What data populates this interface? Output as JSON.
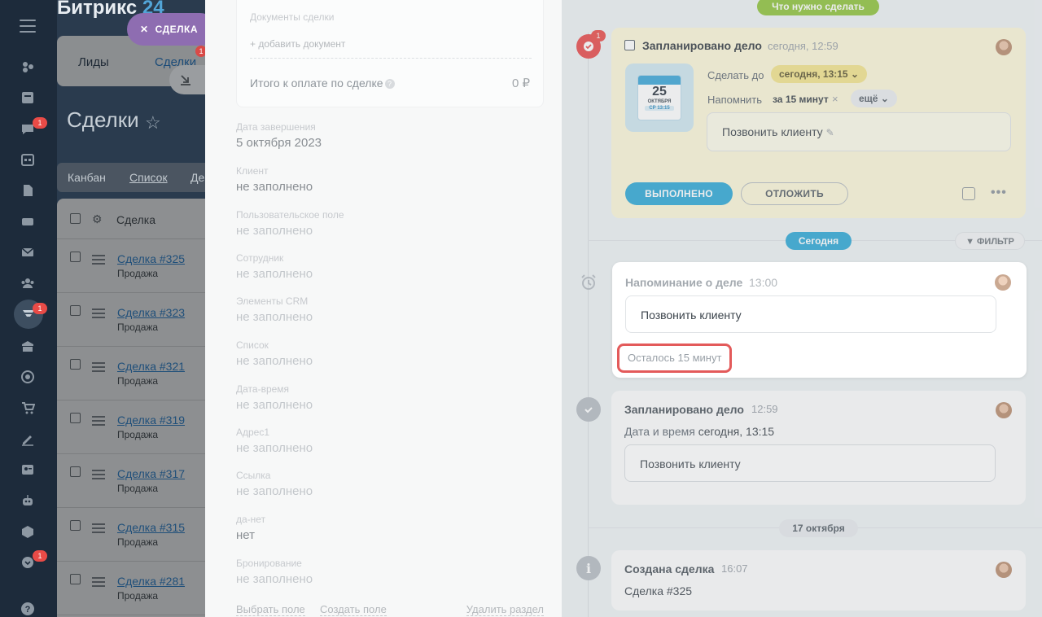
{
  "brand": {
    "name": "Битрикс",
    "num": "24"
  },
  "nav_badges": [
    "1",
    "1",
    "1"
  ],
  "list": {
    "deal_chip": "СДЕЛКА",
    "tabs": [
      "Лиды",
      "Сделки"
    ],
    "tabs_badge": "1",
    "title": "Сделки",
    "view_tabs": [
      "Канбан",
      "Список",
      "Де"
    ],
    "column": "Сделка",
    "rows": [
      {
        "name": "Сделка #325",
        "stage": "Продажа"
      },
      {
        "name": "Сделка #323",
        "stage": "Продажа"
      },
      {
        "name": "Сделка #321",
        "stage": "Продажа"
      },
      {
        "name": "Сделка #319",
        "stage": "Продажа"
      },
      {
        "name": "Сделка #317",
        "stage": "Продажа"
      },
      {
        "name": "Сделка #315",
        "stage": "Продажа"
      },
      {
        "name": "Сделка #281",
        "stage": "Продажа"
      }
    ]
  },
  "fields": {
    "docs_label": "Документы сделки",
    "add_doc": "+ добавить документ",
    "total_label": "Итого к оплате по сделке",
    "total_value": "0 ₽",
    "items": [
      {
        "label": "Дата завершения",
        "value": "5 октября 2023",
        "filled": true
      },
      {
        "label": "Клиент",
        "value": "не заполнено",
        "filled": true
      },
      {
        "label": "Пользовательское поле",
        "value": "не заполнено",
        "filled": false
      },
      {
        "label": "Сотрудник",
        "value": "не заполнено",
        "filled": false
      },
      {
        "label": "Элементы CRM",
        "value": "не заполнено",
        "filled": false
      },
      {
        "label": "Список",
        "value": "не заполнено",
        "filled": false
      },
      {
        "label": "Дата-время",
        "value": "не заполнено",
        "filled": false
      },
      {
        "label": "Адрес1",
        "value": "не заполнено",
        "filled": false
      },
      {
        "label": "Ссылка",
        "value": "не заполнено",
        "filled": false
      },
      {
        "label": "да-нет",
        "value": "нет",
        "filled": true
      },
      {
        "label": "Бронирование",
        "value": "не заполнено",
        "filled": false
      }
    ],
    "links": {
      "select": "Выбрать поле",
      "create": "Создать поле",
      "delete": "Удалить раздел"
    }
  },
  "timeline": {
    "todo_pill": "Что нужно сделать",
    "planned": {
      "badge": "1",
      "title": "Запланировано дело",
      "time": "сегодня, 12:59",
      "calendar": {
        "day": "25",
        "month": "ОКТЯБРЯ",
        "weekday_time": "СР 13:15"
      },
      "do_label": "Сделать до",
      "do_value": "сегодня, 13:15",
      "remind_label": "Напомнить",
      "remind_value": "за 15 минут",
      "more": "ещё",
      "text": "Позвонить клиенту",
      "done_btn": "ВЫПОЛНЕНО",
      "postpone_btn": "ОТЛОЖИТЬ"
    },
    "today_pill": "Сегодня",
    "filter_btn": "ФИЛЬТР",
    "reminder": {
      "title": "Напоминание о деле",
      "time": "13:00",
      "text": "Позвонить клиенту",
      "left": "Осталось 15 минут"
    },
    "planned2": {
      "title": "Запланировано дело",
      "time": "12:59",
      "dt_label": "Дата и время",
      "dt_value": "сегодня, 13:15",
      "text": "Позвонить клиенту"
    },
    "date_pill": "17 октября",
    "created": {
      "title": "Создана сделка",
      "time": "16:07",
      "deal": "Сделка #325"
    }
  }
}
